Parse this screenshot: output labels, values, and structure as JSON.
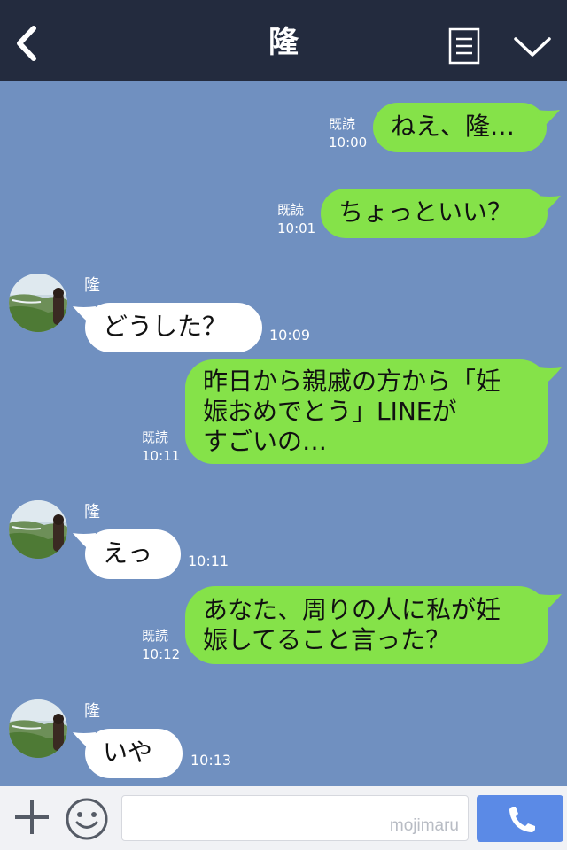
{
  "header": {
    "title": "隆"
  },
  "messages": [
    {
      "side": "me",
      "text": "ねえ、隆…",
      "read": "既読",
      "time": "10:00"
    },
    {
      "side": "me",
      "text": "ちょっといい？",
      "read": "既読",
      "time": "10:01"
    },
    {
      "side": "them",
      "sender": "隆",
      "text": "どうした？",
      "time": "10:09"
    },
    {
      "side": "me",
      "lines": [
        "昨日から親戚の方から「妊",
        "娠おめでとう」LINEが",
        "すごいの…"
      ],
      "read": "既読",
      "time": "10:11"
    },
    {
      "side": "them",
      "sender": "隆",
      "text": "えっ",
      "time": "10:11"
    },
    {
      "side": "me",
      "lines": [
        "あなた、周りの人に私が妊",
        "娠してること言った？"
      ],
      "read": "既読",
      "time": "10:12"
    },
    {
      "side": "them",
      "sender": "隆",
      "text": "いや",
      "time": "10:13"
    }
  ],
  "footer": {
    "input_value": "",
    "watermark": "mojimaru"
  },
  "colors": {
    "header_bg": "#232b3e",
    "chat_bg": "#7090c0",
    "my_bubble": "#85e249",
    "their_bubble": "#ffffff",
    "call_button": "#5b8ae6"
  },
  "icons": [
    "back-arrow-icon",
    "notes-icon",
    "chevron-down-icon",
    "plus-icon",
    "emoji-icon",
    "phone-icon"
  ]
}
